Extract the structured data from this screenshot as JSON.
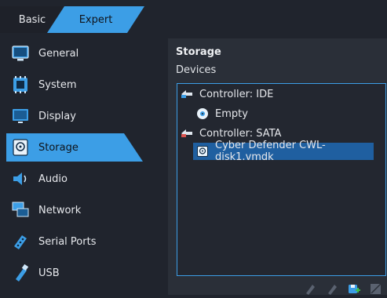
{
  "tabs": {
    "basic": "Basic",
    "expert": "Expert"
  },
  "sidebar": {
    "items": [
      {
        "label": "General",
        "icon": "monitor-icon"
      },
      {
        "label": "System",
        "icon": "chip-icon"
      },
      {
        "label": "Display",
        "icon": "display-icon"
      },
      {
        "label": "Storage",
        "icon": "disk-icon"
      },
      {
        "label": "Audio",
        "icon": "speaker-icon"
      },
      {
        "label": "Network",
        "icon": "network-icon"
      },
      {
        "label": "Serial Ports",
        "icon": "serial-port-icon"
      },
      {
        "label": "USB",
        "icon": "usb-icon"
      }
    ],
    "active": "Storage"
  },
  "panel": {
    "title": "Storage",
    "devices_label": "Devices",
    "tree": [
      {
        "label": "Controller: IDE",
        "icon": "ide-controller-icon"
      },
      {
        "label": "Empty",
        "icon": "optical-disc-icon"
      },
      {
        "label": "Controller: SATA",
        "icon": "sata-controller-icon"
      },
      {
        "label": "Cyber Defender CWL-disk1.vmdk",
        "icon": "hard-disk-icon",
        "selected": true
      }
    ],
    "toolbar": [
      "add-controller-icon",
      "remove-controller-icon",
      "add-attachment-icon",
      "remove-attachment-icon"
    ]
  },
  "colors": {
    "accent": "#3c9ee6",
    "background": "#20242d",
    "panel": "#2a2f38",
    "selection": "#1f5fa0"
  }
}
